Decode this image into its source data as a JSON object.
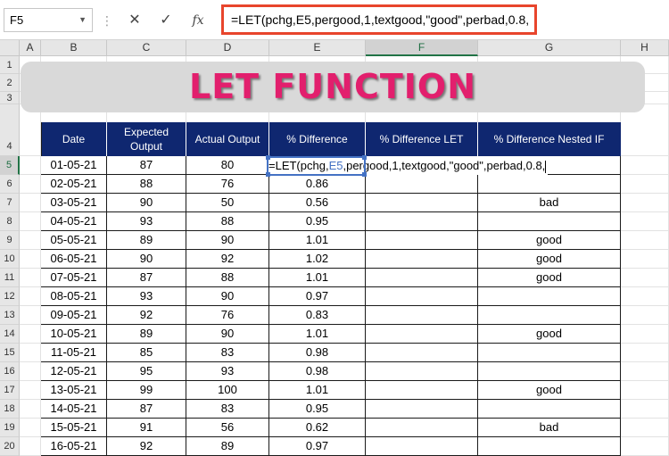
{
  "formula_bar": {
    "name_box": "F5",
    "cancel_icon": "✕",
    "enter_icon": "✓",
    "fx_label": "fx",
    "formula": "=LET(pchg,E5,pergood,1,textgood,\"good\",perbad,0.8,"
  },
  "columns": [
    "A",
    "B",
    "C",
    "D",
    "E",
    "F",
    "G",
    "H"
  ],
  "rows": [
    "1",
    "2",
    "3",
    "4",
    "5",
    "6",
    "7",
    "8",
    "9",
    "10",
    "11",
    "12",
    "13",
    "14",
    "15",
    "16",
    "17",
    "18",
    "19",
    "20"
  ],
  "title": "LET FUNCTION",
  "table": {
    "headers": {
      "date": "Date",
      "expected_1": "Expected",
      "expected_2": "Output",
      "actual": "Actual Output",
      "pct_diff": "% Difference",
      "pct_let": "% Difference LET",
      "pct_nested": "% Difference Nested IF"
    },
    "editing": {
      "pre": "=LET(pchg,",
      "ref": "E5",
      "post": ",pergood,1,textgood,\"good\",perbad,0.8,"
    },
    "rows": [
      {
        "date": "01-05-21",
        "expected": "87",
        "actual": "80",
        "pct": "",
        "let": "",
        "nested": ""
      },
      {
        "date": "02-05-21",
        "expected": "88",
        "actual": "76",
        "pct": "0.86",
        "let": "",
        "nested": ""
      },
      {
        "date": "03-05-21",
        "expected": "90",
        "actual": "50",
        "pct": "0.56",
        "let": "",
        "nested": "bad"
      },
      {
        "date": "04-05-21",
        "expected": "93",
        "actual": "88",
        "pct": "0.95",
        "let": "",
        "nested": ""
      },
      {
        "date": "05-05-21",
        "expected": "89",
        "actual": "90",
        "pct": "1.01",
        "let": "",
        "nested": "good"
      },
      {
        "date": "06-05-21",
        "expected": "90",
        "actual": "92",
        "pct": "1.02",
        "let": "",
        "nested": "good"
      },
      {
        "date": "07-05-21",
        "expected": "87",
        "actual": "88",
        "pct": "1.01",
        "let": "",
        "nested": "good"
      },
      {
        "date": "08-05-21",
        "expected": "93",
        "actual": "90",
        "pct": "0.97",
        "let": "",
        "nested": ""
      },
      {
        "date": "09-05-21",
        "expected": "92",
        "actual": "76",
        "pct": "0.83",
        "let": "",
        "nested": ""
      },
      {
        "date": "10-05-21",
        "expected": "89",
        "actual": "90",
        "pct": "1.01",
        "let": "",
        "nested": "good"
      },
      {
        "date": "11-05-21",
        "expected": "85",
        "actual": "83",
        "pct": "0.98",
        "let": "",
        "nested": ""
      },
      {
        "date": "12-05-21",
        "expected": "95",
        "actual": "93",
        "pct": "0.98",
        "let": "",
        "nested": ""
      },
      {
        "date": "13-05-21",
        "expected": "99",
        "actual": "100",
        "pct": "1.01",
        "let": "",
        "nested": "good"
      },
      {
        "date": "14-05-21",
        "expected": "87",
        "actual": "83",
        "pct": "0.95",
        "let": "",
        "nested": ""
      },
      {
        "date": "15-05-21",
        "expected": "91",
        "actual": "56",
        "pct": "0.62",
        "let": "",
        "nested": "bad"
      },
      {
        "date": "16-05-21",
        "expected": "92",
        "actual": "89",
        "pct": "0.97",
        "let": "",
        "nested": ""
      }
    ]
  },
  "colors": {
    "header_bg": "#0f2770",
    "title_color": "#e21f6d",
    "highlight_border": "#e8452c",
    "selection": "#217346"
  }
}
